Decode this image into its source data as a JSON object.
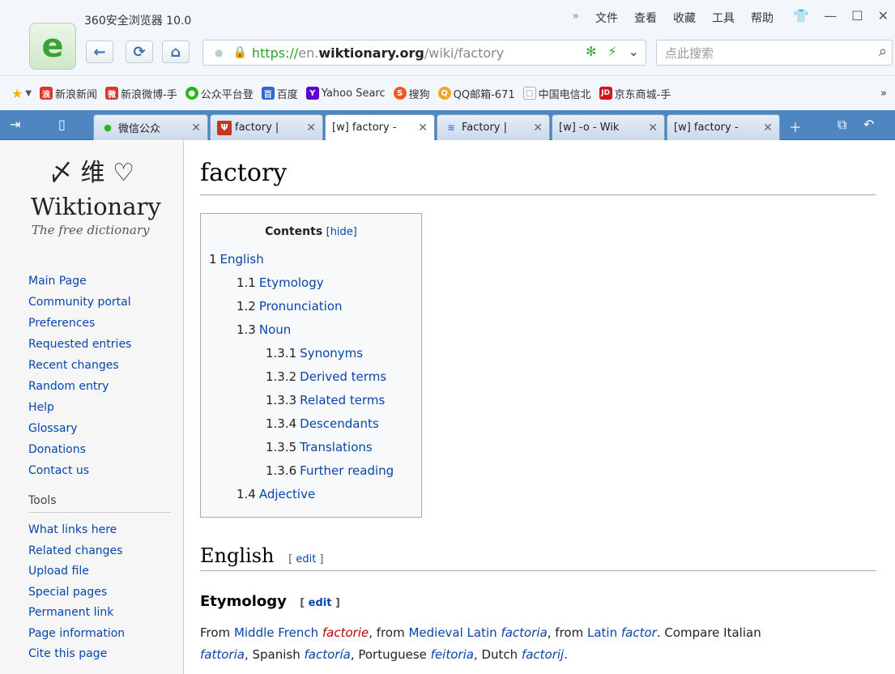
{
  "browser": {
    "app_title": "360安全浏览器 10.0",
    "menu": [
      "»",
      "文件",
      "查看",
      "收藏",
      "工具",
      "帮助"
    ],
    "url": {
      "scheme": "https://",
      "host_prefix": "en.",
      "domain": "wiktionary.org",
      "path": "/wiki/factory"
    },
    "search_placeholder": "点此搜索",
    "bookmarks": [
      {
        "label": "新浪新闻",
        "color": "#e0372c",
        "glyph": "浪"
      },
      {
        "label": "新浪微博-手",
        "color": "#e0372c",
        "glyph": "微"
      },
      {
        "label": "公众平台登",
        "color": "#2db51c",
        "glyph": "●"
      },
      {
        "label": "百度",
        "color": "#2f66d6",
        "glyph": "百"
      },
      {
        "label": "Yahoo Searc",
        "color": "#5f01d1",
        "glyph": "Y"
      },
      {
        "label": "搜狗",
        "color": "#f05a22",
        "glyph": "S"
      },
      {
        "label": "QQ邮箱-671",
        "color": "#f6a623",
        "glyph": "Q"
      },
      {
        "label": "中国电信北",
        "color": "#cfd6de",
        "glyph": "□"
      },
      {
        "label": "京东商城-手",
        "color": "#d1141d",
        "glyph": "JD"
      }
    ],
    "tabs": [
      {
        "label": "微信公众",
        "fav": "●",
        "fav_color": "#2db51c"
      },
      {
        "label": "factory |",
        "fav": "Ψ",
        "fav_color": "#c9341f"
      },
      {
        "label": "[w] factory -",
        "fav": "",
        "fav_color": "#222"
      },
      {
        "label": "Factory |",
        "fav": "≋",
        "fav_color": "#3a7bd5"
      },
      {
        "label": "[w] -o - Wik",
        "fav": "",
        "fav_color": "#222"
      },
      {
        "label": "[w] factory -",
        "fav": "",
        "fav_color": "#222"
      }
    ]
  },
  "sidebar": {
    "logo_cjk": "维",
    "logo_name": "Wiktionary",
    "logo_sub": "The free dictionary",
    "nav": [
      "Main Page",
      "Community portal",
      "Preferences",
      "Requested entries",
      "Recent changes",
      "Random entry",
      "Help",
      "Glossary",
      "Donations",
      "Contact us"
    ],
    "tools_heading": "Tools",
    "tools": [
      "What links here",
      "Related changes",
      "Upload file",
      "Special pages",
      "Permanent link",
      "Page information",
      "Cite this page"
    ]
  },
  "page": {
    "title": "factory",
    "toc": {
      "heading": "Contents",
      "hide": "[hide]",
      "items": [
        {
          "num": "1",
          "text": "English",
          "level": 1
        },
        {
          "num": "1.1",
          "text": "Etymology",
          "level": 2
        },
        {
          "num": "1.2",
          "text": "Pronunciation",
          "level": 2
        },
        {
          "num": "1.3",
          "text": "Noun",
          "level": 2
        },
        {
          "num": "1.3.1",
          "text": "Synonyms",
          "level": 3
        },
        {
          "num": "1.3.2",
          "text": "Derived terms",
          "level": 3
        },
        {
          "num": "1.3.3",
          "text": "Related terms",
          "level": 3
        },
        {
          "num": "1.3.4",
          "text": "Descendants",
          "level": 3
        },
        {
          "num": "1.3.5",
          "text": "Translations",
          "level": 3
        },
        {
          "num": "1.3.6",
          "text": "Further reading",
          "level": 3
        },
        {
          "num": "1.4",
          "text": "Adjective",
          "level": 2
        }
      ]
    },
    "section_english": "English",
    "section_etymology": "Etymology",
    "edit_label": "edit",
    "etymology_line1": {
      "from1": "From ",
      "middle_french": "Middle French",
      "factorie": "factorie",
      "from2": ", from ",
      "medieval_latin": "Medieval Latin",
      "factoria": "factoria",
      "from3": ", from ",
      "latin": "Latin",
      "factor": "factor",
      "compare": ". Compare Italian"
    },
    "etymology_line2": {
      "fattoria": "fattoria",
      "spanish": ", Spanish ",
      "factoria_es": "factoría",
      "portuguese": ", Portuguese ",
      "feitoria": "feitoria",
      "dutch": ", Dutch ",
      "factorij": "factorij",
      "end": "."
    }
  }
}
